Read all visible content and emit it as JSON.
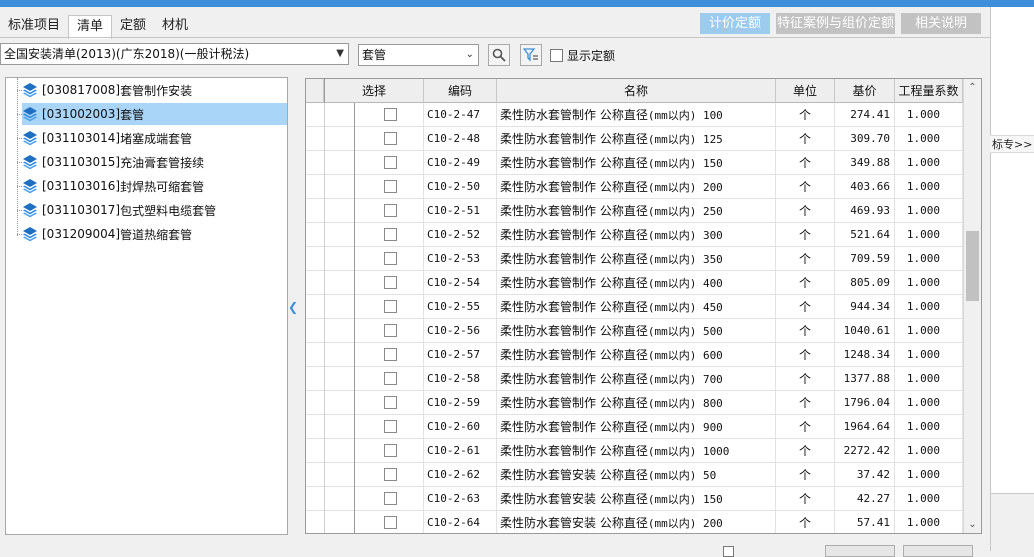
{
  "tabs": [
    {
      "label": "标准项目",
      "active": false
    },
    {
      "label": "清单",
      "active": true
    },
    {
      "label": "定额",
      "active": false
    },
    {
      "label": "材机",
      "active": false
    }
  ],
  "top_buttons": [
    {
      "label": "计价定额",
      "active": true
    },
    {
      "label": "特征案例与组价定额",
      "active": false
    },
    {
      "label": "相关说明",
      "active": false
    }
  ],
  "library_select": {
    "value": "全国安装清单(2013)(广东2018)(一般计税法)"
  },
  "search_select": {
    "value": "套管"
  },
  "show_quota": {
    "label": "显示定额",
    "checked": false
  },
  "right_side_tab": {
    "label": "标专>>"
  },
  "tree": [
    {
      "code": "[030817008]",
      "name": "套管制作安装",
      "selected": false
    },
    {
      "code": "[031002003]",
      "name": "套管",
      "selected": true
    },
    {
      "code": "[031103014]",
      "name": "堵塞成端套管",
      "selected": false
    },
    {
      "code": "[031103015]",
      "name": "充油膏套管接续",
      "selected": false
    },
    {
      "code": "[031103016]",
      "name": "封焊热可缩套管",
      "selected": false
    },
    {
      "code": "[031103017]",
      "name": "包式塑料电缆套管",
      "selected": false
    },
    {
      "code": "[031209004]",
      "name": "管道热缩套管",
      "selected": false
    }
  ],
  "grid": {
    "columns": {
      "select": "选择",
      "code": "编码",
      "name": "名称",
      "unit": "单位",
      "price": "基价",
      "coef": "工程量系数"
    },
    "rows": [
      {
        "code": "C10-2-47",
        "name": "柔性防水套管制作 公称直径",
        "spec": "(mm以内) 100",
        "unit": "个",
        "price": "274.41",
        "coef": "1.000"
      },
      {
        "code": "C10-2-48",
        "name": "柔性防水套管制作 公称直径",
        "spec": "(mm以内) 125",
        "unit": "个",
        "price": "309.70",
        "coef": "1.000"
      },
      {
        "code": "C10-2-49",
        "name": "柔性防水套管制作 公称直径",
        "spec": "(mm以内) 150",
        "unit": "个",
        "price": "349.88",
        "coef": "1.000"
      },
      {
        "code": "C10-2-50",
        "name": "柔性防水套管制作 公称直径",
        "spec": "(mm以内) 200",
        "unit": "个",
        "price": "403.66",
        "coef": "1.000"
      },
      {
        "code": "C10-2-51",
        "name": "柔性防水套管制作 公称直径",
        "spec": "(mm以内) 250",
        "unit": "个",
        "price": "469.93",
        "coef": "1.000"
      },
      {
        "code": "C10-2-52",
        "name": "柔性防水套管制作 公称直径",
        "spec": "(mm以内) 300",
        "unit": "个",
        "price": "521.64",
        "coef": "1.000"
      },
      {
        "code": "C10-2-53",
        "name": "柔性防水套管制作 公称直径",
        "spec": "(mm以内) 350",
        "unit": "个",
        "price": "709.59",
        "coef": "1.000"
      },
      {
        "code": "C10-2-54",
        "name": "柔性防水套管制作 公称直径",
        "spec": "(mm以内) 400",
        "unit": "个",
        "price": "805.09",
        "coef": "1.000"
      },
      {
        "code": "C10-2-55",
        "name": "柔性防水套管制作 公称直径",
        "spec": "(mm以内) 450",
        "unit": "个",
        "price": "944.34",
        "coef": "1.000"
      },
      {
        "code": "C10-2-56",
        "name": "柔性防水套管制作 公称直径",
        "spec": "(mm以内) 500",
        "unit": "个",
        "price": "1040.61",
        "coef": "1.000"
      },
      {
        "code": "C10-2-57",
        "name": "柔性防水套管制作 公称直径",
        "spec": "(mm以内) 600",
        "unit": "个",
        "price": "1248.34",
        "coef": "1.000"
      },
      {
        "code": "C10-2-58",
        "name": "柔性防水套管制作 公称直径",
        "spec": "(mm以内) 700",
        "unit": "个",
        "price": "1377.88",
        "coef": "1.000"
      },
      {
        "code": "C10-2-59",
        "name": "柔性防水套管制作 公称直径",
        "spec": "(mm以内) 800",
        "unit": "个",
        "price": "1796.04",
        "coef": "1.000"
      },
      {
        "code": "C10-2-60",
        "name": "柔性防水套管制作 公称直径",
        "spec": "(mm以内) 900",
        "unit": "个",
        "price": "1964.64",
        "coef": "1.000"
      },
      {
        "code": "C10-2-61",
        "name": "柔性防水套管制作 公称直径",
        "spec": "(mm以内) 1000",
        "unit": "个",
        "price": "2272.42",
        "coef": "1.000"
      },
      {
        "code": "C10-2-62",
        "name": "柔性防水套管安装 公称直径",
        "spec": "(mm以内) 50",
        "unit": "个",
        "price": "37.42",
        "coef": "1.000"
      },
      {
        "code": "C10-2-63",
        "name": "柔性防水套管安装 公称直径",
        "spec": "(mm以内) 150",
        "unit": "个",
        "price": "42.27",
        "coef": "1.000"
      },
      {
        "code": "C10-2-64",
        "name": "柔性防水套管安装 公称直径",
        "spec": "(mm以内) 200",
        "unit": "个",
        "price": "57.41",
        "coef": "1.000"
      }
    ]
  },
  "colors": {
    "accent": "#3c8fd8",
    "selected_row": "#a8d5f8",
    "active_button": "#9ccbee",
    "inactive_button": "#c2c2c2"
  }
}
